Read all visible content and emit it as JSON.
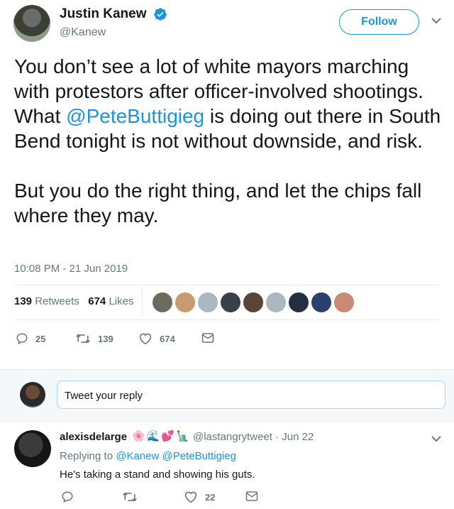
{
  "author": {
    "name": "Justin Kanew",
    "handle": "@Kanew",
    "verified": true,
    "avatar_icon": "profile-photo"
  },
  "follow_label": "Follow",
  "tweet": {
    "para1_before_mention": "You don’t see a lot of white mayors marching with protestors after officer-involved shootings. What ",
    "mention": "@PeteButtigieg",
    "para1_after_mention": " is doing out there in South Bend tonight is not without downside, and risk.",
    "para2": "But you do the right thing, and let the chips fall where they may.",
    "timestamp": "10:08 PM - 21 Jun 2019"
  },
  "stats": {
    "retweets_count": "139",
    "retweets_label": "Retweets",
    "likes_count": "674",
    "likes_label": "Likes",
    "liker_colors": [
      "#6d6a5f",
      "#c89a70",
      "#aab8c2",
      "#3a3f4a",
      "#5a4636",
      "#aab8c2",
      "#24303f",
      "#2d3f6e",
      "#c98a78"
    ]
  },
  "actions": {
    "reply_count": "25",
    "retweet_count": "139",
    "like_count": "674"
  },
  "reply_box": {
    "placeholder": "Tweet your reply"
  },
  "reply_tweet": {
    "name": "alexisdelarge",
    "emojis": [
      "🌸",
      "🌊",
      "💕",
      "🗽"
    ],
    "handle": "@lastangrytweet",
    "date": "Jun 22",
    "replying_label": "Replying to",
    "replying_to_1": "@Kanew",
    "replying_to_2": "@PeteButtigieg",
    "text": "He's taking a stand and showing his guts.",
    "like_count": "22"
  },
  "colors": {
    "accent": "#1b95e0",
    "muted": "#657786",
    "text": "#14171a",
    "divider": "#e6ecf0"
  }
}
